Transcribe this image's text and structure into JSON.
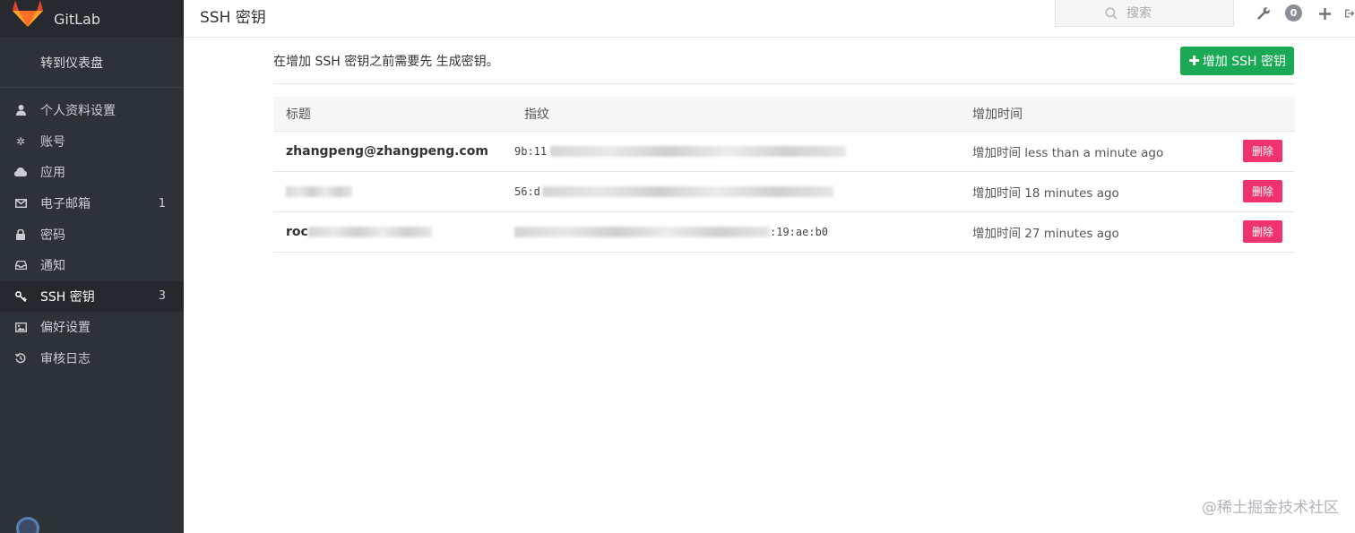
{
  "app": {
    "name": "GitLab"
  },
  "sidebar": {
    "dashboard_link": "转到仪表盘",
    "items": [
      {
        "label": "个人资料设置",
        "icon": "user-icon",
        "count": ""
      },
      {
        "label": "账号",
        "icon": "gear-icon",
        "count": ""
      },
      {
        "label": "应用",
        "icon": "cloud-icon",
        "count": ""
      },
      {
        "label": "电子邮箱",
        "icon": "envelope-icon",
        "count": "1"
      },
      {
        "label": "密码",
        "icon": "lock-icon",
        "count": ""
      },
      {
        "label": "通知",
        "icon": "inbox-icon",
        "count": ""
      },
      {
        "label": "SSH 密钥",
        "icon": "key-icon",
        "count": "3",
        "active": true
      },
      {
        "label": "偏好设置",
        "icon": "image-icon",
        "count": ""
      },
      {
        "label": "审核日志",
        "icon": "history-icon",
        "count": ""
      }
    ]
  },
  "header": {
    "title": "SSH 密钥",
    "search_placeholder": "搜索",
    "todo_count": "0"
  },
  "main": {
    "info_text": "在增加 SSH 密钥之前需要先 生成密钥。",
    "add_button": "增加 SSH 密钥",
    "columns": [
      "标题",
      "指纹",
      "增加时间"
    ],
    "rows": [
      {
        "title": "zhangpeng@zhangpeng.com",
        "fingerprint": "9b:11",
        "added": "增加时间 less than a minute ago",
        "delete": "删除"
      },
      {
        "title": "",
        "fingerprint": "56:d",
        "added": "增加时间 18 minutes ago",
        "delete": "删除"
      },
      {
        "title": "roc",
        "fingerprint": ":19:ae:b0",
        "added": "增加时间 27 minutes ago",
        "delete": "删除"
      }
    ]
  },
  "watermark": "@稀土掘金技术社区",
  "colors": {
    "sidebar_bg": "#2d3237",
    "accent_green": "#1aaa55",
    "delete_red": "#f0336e",
    "logo_orange": "#e24329"
  }
}
